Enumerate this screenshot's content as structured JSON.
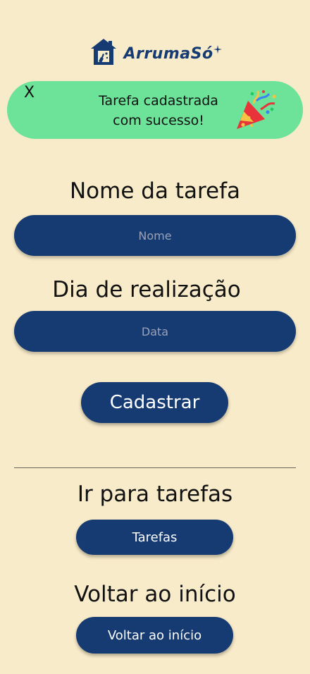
{
  "app": {
    "name": "ArrumaSó",
    "logo_icon": "house-cleaning-icon"
  },
  "toast": {
    "close_label": "X",
    "line1": "Tarefa cadastrada",
    "line2": "com sucesso!",
    "icon": "party-popper-icon"
  },
  "form": {
    "task_name_heading": "Nome da tarefa",
    "task_name_placeholder": "Nome",
    "task_name_value": "",
    "date_heading": "Dia de realização",
    "date_placeholder": "Data",
    "date_value": "",
    "submit_label": "Cadastrar"
  },
  "nav": {
    "tasks_heading": "Ir para tarefas",
    "tasks_button": "Tarefas",
    "home_heading": "Voltar ao início",
    "home_button": "Voltar ao início"
  },
  "colors": {
    "background": "#f8ebc9",
    "primary": "#163b73",
    "toast": "#6ce399"
  }
}
